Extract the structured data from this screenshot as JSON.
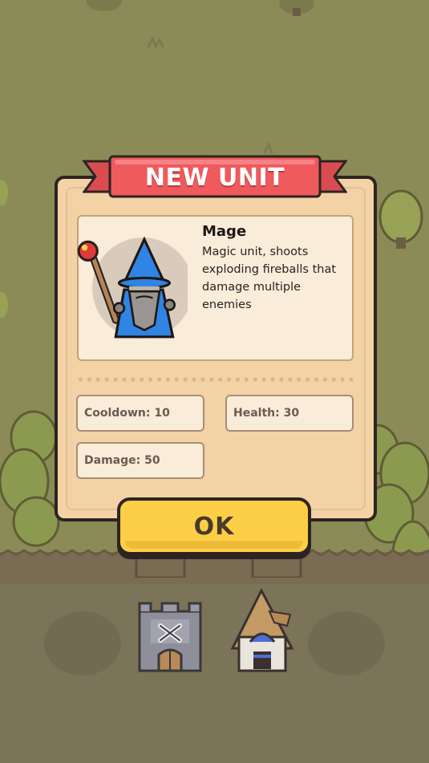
{
  "popup": {
    "title": "NEW UNIT",
    "unit": {
      "name": "Mage",
      "description": "Magic unit, shoots exploding fireballs that damage multiple enemies",
      "portrait_icon": "mage-wizard-icon"
    },
    "stats": [
      {
        "label": "Cooldown: 10"
      },
      {
        "label": "Health: 30"
      },
      {
        "label": "Damage: 50"
      }
    ],
    "ok_label": "OK"
  },
  "base": {
    "buildings": [
      {
        "icon": "barracks-castle-icon"
      },
      {
        "icon": "mage-house-icon"
      }
    ]
  },
  "colors": {
    "ribbon": "#ef5a5c",
    "card": "#f3d2a6",
    "button": "#fccf47",
    "grass": "#8b8b58",
    "ground": "#7c7458"
  }
}
